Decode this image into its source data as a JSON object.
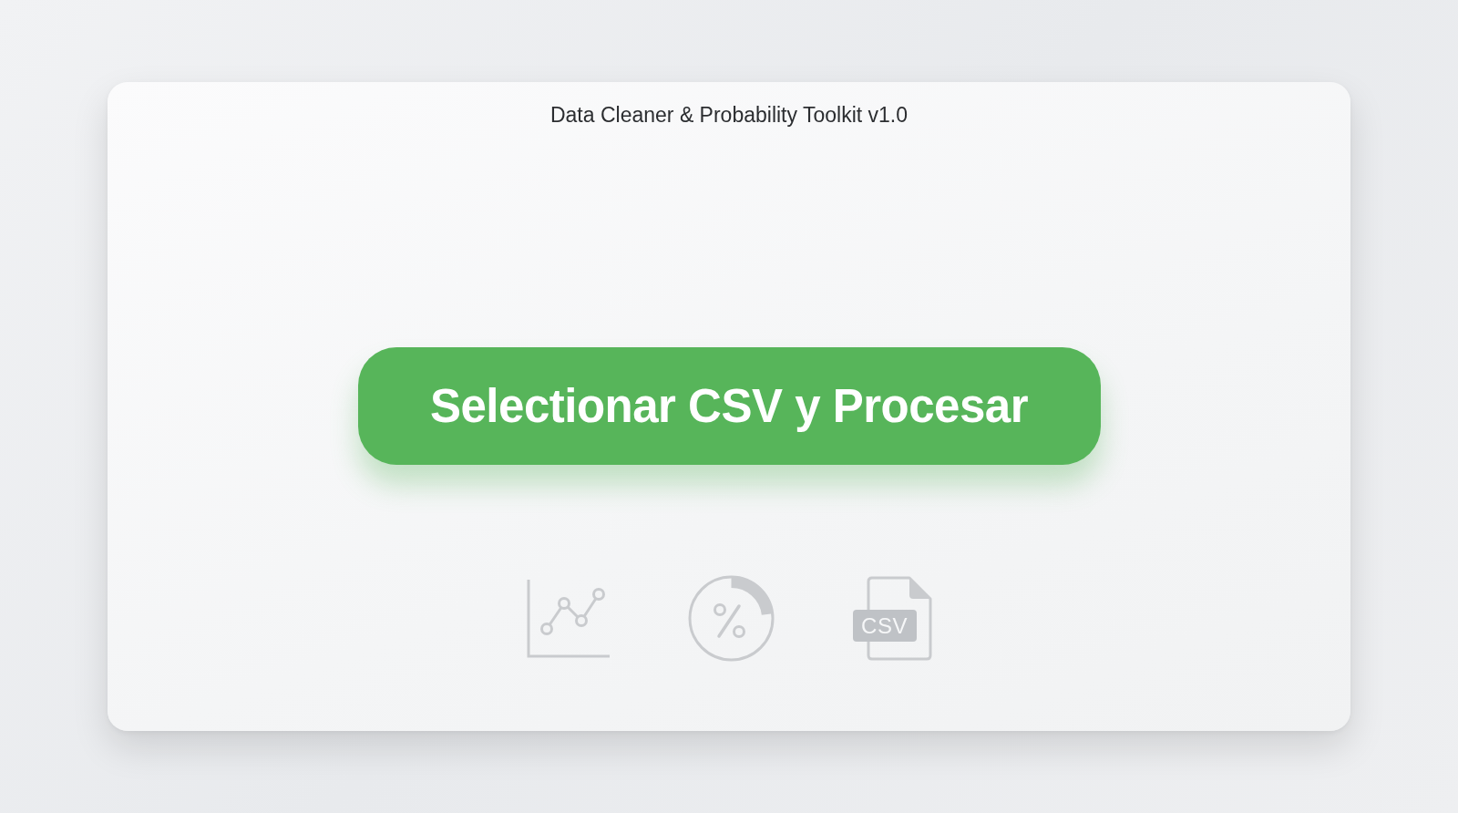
{
  "title": "Data Cleaner & Probability Toolkit v1.0",
  "primary_button": {
    "label": "Selectionar CSV y Procesar"
  },
  "icons": [
    {
      "kind": "line_chart"
    },
    {
      "kind": "percent"
    },
    {
      "kind": "file",
      "label": "CSV"
    }
  ]
}
